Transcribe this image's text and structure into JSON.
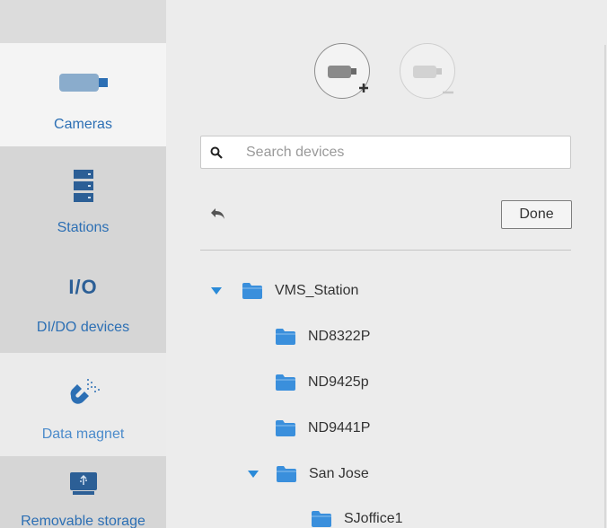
{
  "sidebar": {
    "items": [
      {
        "label": "Cameras",
        "icon": "camera-icon"
      },
      {
        "label": "Stations",
        "icon": "server-icon"
      },
      {
        "label": "I/O",
        "sub": "DI/DO devices",
        "icon": "io-icon"
      },
      {
        "label": "Data magnet",
        "icon": "magnet-icon"
      },
      {
        "label": "Removable storage",
        "icon": "usb-drive-icon"
      }
    ]
  },
  "toolbar": {
    "add_camera_icon": "add-camera-icon",
    "remove_camera_icon": "remove-camera-icon"
  },
  "search": {
    "placeholder": "Search devices"
  },
  "actions": {
    "done_label": "Done"
  },
  "tree": [
    {
      "label": "VMS_Station",
      "expanded": true
    },
    {
      "label": "ND8322P"
    },
    {
      "label": "ND9425p"
    },
    {
      "label": "ND9441P"
    },
    {
      "label": "San Jose",
      "expanded": true
    },
    {
      "label": "SJoffice1"
    }
  ],
  "colors": {
    "accent": "#2c6fb4",
    "folder": "#3a8fdc",
    "caret": "#2a8ad8"
  }
}
